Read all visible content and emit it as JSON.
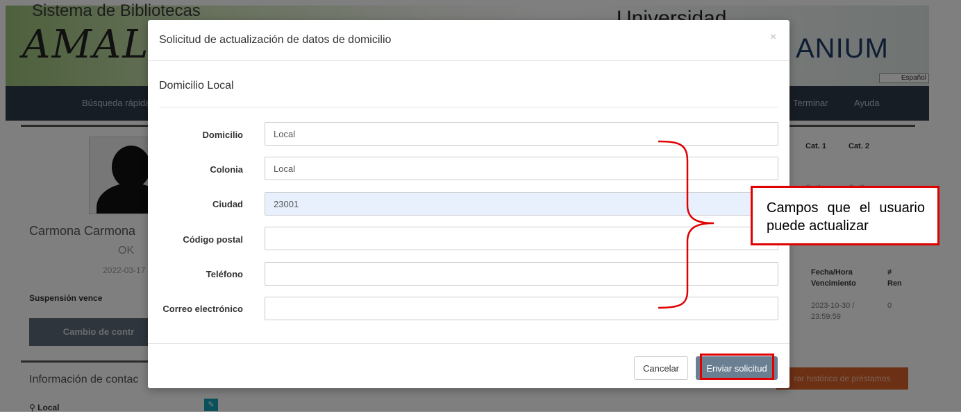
{
  "background": {
    "system_title": "Sistema de Bibliotecas",
    "logo_text": "AMAL",
    "university_text": "Universidad",
    "brand_suffix": "ANIUM",
    "language": "Español",
    "nav": {
      "quick_search": "Búsqueda rápida",
      "finish": "Terminar",
      "help": "Ayuda"
    },
    "profile": {
      "name": "Carmona Carmona",
      "status": "OK",
      "date": "2022-03-17",
      "suspension_label": "Suspensión vence",
      "change_button": "Cambio de contr"
    },
    "contact": {
      "title": "Información de contac",
      "location": "Local"
    },
    "loans": {
      "cat1": "Cat. 1",
      "cat2": "Cat. 2",
      "cat1_short": "Cat1",
      "cat2_short": "Cat2",
      "due_header_1": "Fecha/Hora",
      "due_header_2": "Vencimiento",
      "ren_header_1": "#",
      "ren_header_2": "Ren",
      "due_value_1": "2023-10-30 /",
      "due_value_2": "23:59:59",
      "ren_value": "0",
      "history_button": "rar histórico de préstamos"
    }
  },
  "modal": {
    "title": "Solicitud de actualización de datos de domicilio",
    "close": "×",
    "section": "Domicilio Local",
    "fields": [
      {
        "label": "Domicilio",
        "value": "Local"
      },
      {
        "label": "Colonia",
        "value": "Local"
      },
      {
        "label": "Ciudad",
        "value": "23001"
      },
      {
        "label": "Código postal",
        "value": ""
      },
      {
        "label": "Teléfono",
        "value": ""
      },
      {
        "label": "Correo electrónico",
        "value": ""
      }
    ],
    "cancel_button": "Cancelar",
    "send_button": "Enviar solicitud"
  },
  "annotation": {
    "callout_text": "Campos que el usuario puede actualizar",
    "color": "#e00000"
  }
}
